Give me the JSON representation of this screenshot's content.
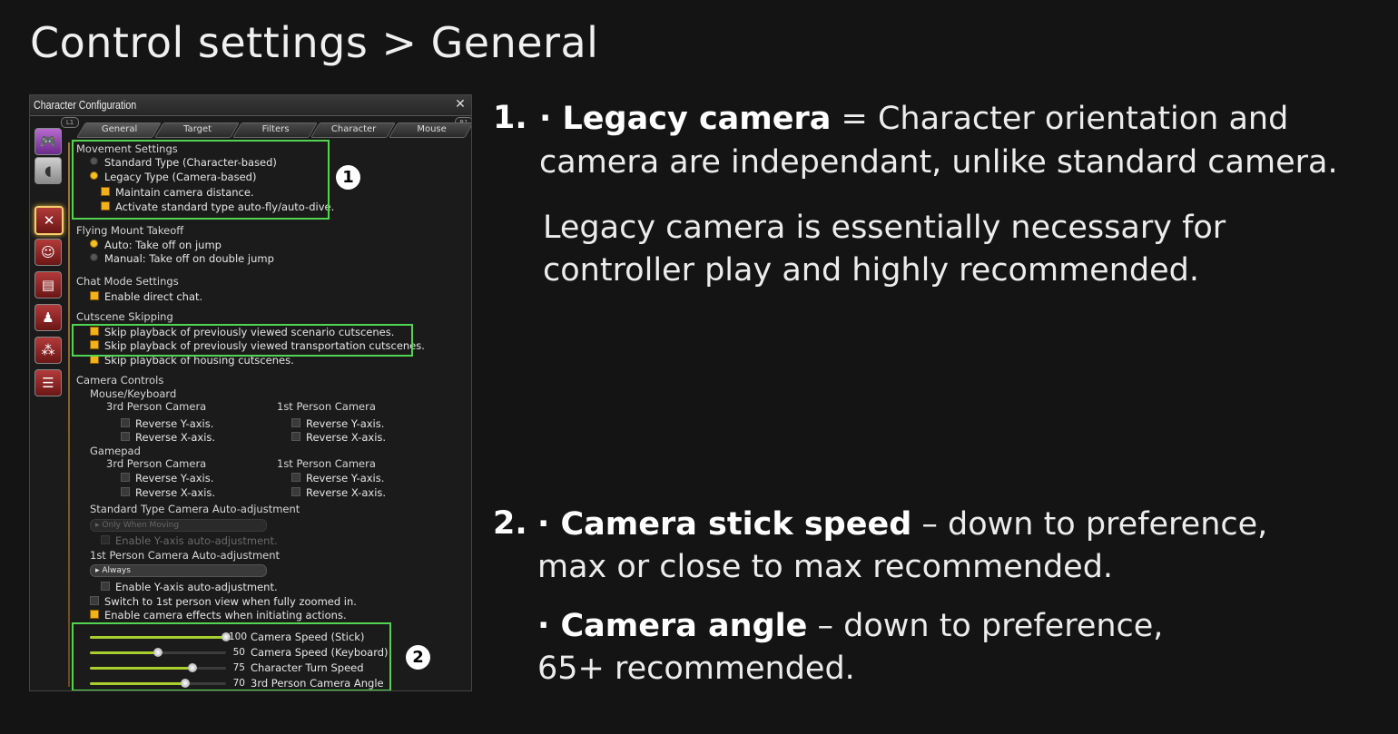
{
  "page_title": "Control settings > General",
  "window": {
    "title": "Character Configuration",
    "close_icon": "close-icon",
    "tabs": [
      "General",
      "Target",
      "Filters",
      "Character",
      "Mouse"
    ],
    "badges": {
      "left": "L1",
      "right": "R1"
    },
    "side_icons": [
      "gamepad-icon",
      "mouse-icon",
      "crossed-arrows-icon",
      "character-icon",
      "hud-icon",
      "person-icon",
      "party-icon",
      "chat-icon"
    ]
  },
  "movement": {
    "heading": "Movement Settings",
    "standard": "Standard Type (Character-based)",
    "legacy": "Legacy Type (Camera-based)",
    "maintain": "Maintain camera distance.",
    "autofly": "Activate standard type auto-fly/auto-dive."
  },
  "flying": {
    "heading": "Flying Mount Takeoff",
    "auto": "Auto: Take off on jump",
    "manual": "Manual: Take off on double jump"
  },
  "chat": {
    "heading": "Chat Mode Settings",
    "direct": "Enable direct chat."
  },
  "cutscene": {
    "heading": "Cutscene Skipping",
    "scenario": "Skip playback of previously viewed scenario cutscenes.",
    "transport": "Skip playback of previously viewed transportation cutscenes.",
    "housing": "Skip playback of housing cutscenes."
  },
  "camera": {
    "heading": "Camera Controls",
    "mouse_keyboard": "Mouse/Keyboard",
    "gamepad": "Gamepad",
    "third": "3rd Person Camera",
    "first": "1st Person Camera",
    "rev_y": "Reverse Y-axis.",
    "rev_x": "Reverse X-axis.",
    "std_auto": "Standard Type Camera Auto-adjustment",
    "std_auto_value": "▸ Only When Moving",
    "std_enable_y": "Enable Y-axis auto-adjustment.",
    "first_auto": "1st Person Camera Auto-adjustment",
    "first_auto_value": "▸ Always",
    "first_enable_y": "Enable Y-axis auto-adjustment.",
    "switch_first": "Switch to 1st person view when fully zoomed in.",
    "effects": "Enable camera effects when initiating actions."
  },
  "sliders": [
    {
      "name": "Camera Speed (Stick)",
      "value": 100,
      "fraction": 1.0
    },
    {
      "name": "Camera Speed (Keyboard)",
      "value": 50,
      "fraction": 0.5
    },
    {
      "name": "Character Turn Speed",
      "value": 75,
      "fraction": 0.75
    },
    {
      "name": "3rd Person Camera Angle",
      "value": 70,
      "fraction": 0.7
    }
  ],
  "callouts": {
    "one": "1",
    "two": "2"
  },
  "notes": {
    "n1": "1.",
    "n1_bold": "· Legacy camera",
    "n1_rest_a": " = Character orientation and",
    "n1_rest_b": "camera are independant, unlike standard camera.",
    "n1_p2a": "Legacy camera is essentially necessary for",
    "n1_p2b": "controller play and highly recommended.",
    "n2": "2.",
    "n2_bold": "· Camera stick speed",
    "n2_rest_a": " – down to preference,",
    "n2_rest_b": "max or close to max recommended.",
    "n3_bold": "· Camera angle",
    "n3_rest_a": " – down to preference,",
    "n3_rest_b": "65+ recommended."
  },
  "colors": {
    "highlight": "#52d452",
    "slider_fill": "#a9cf2e",
    "checkbox_on": "#f2b21a"
  }
}
